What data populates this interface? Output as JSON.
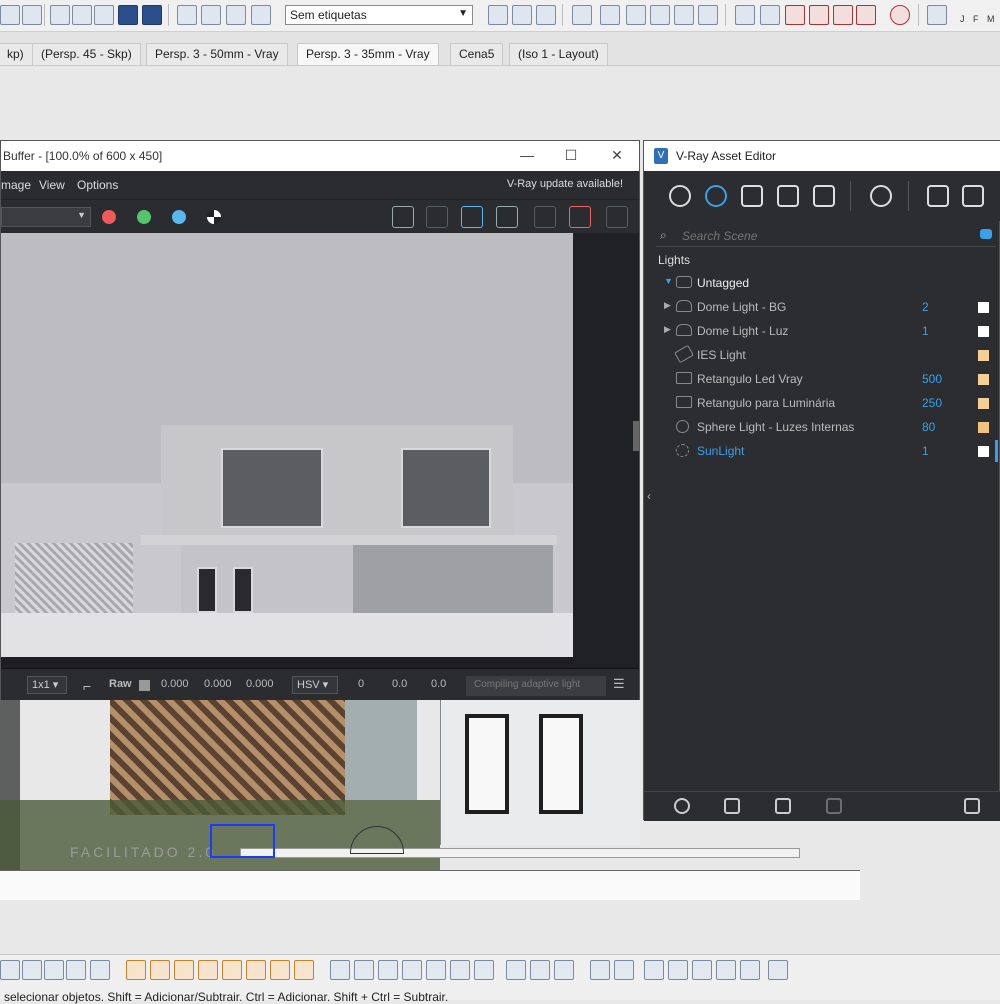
{
  "toolbar": {
    "tag_select_value": "Sem etiquetas",
    "month_strip": "J F M"
  },
  "scene_tabs": [
    {
      "label": "kp)"
    },
    {
      "label": "(Persp. 45 - Skp)"
    },
    {
      "label": "Persp. 3 - 50mm - Vray"
    },
    {
      "label": "Persp. 3 - 35mm - Vray"
    },
    {
      "label": "Cena5"
    },
    {
      "label": "(Iso 1 - Layout)"
    }
  ],
  "frame_buffer": {
    "title": "Buffer - [100.0% of 600 x 450]",
    "menus": [
      "mage",
      "View",
      "Options"
    ],
    "update_notice": "V-Ray update available!",
    "status": {
      "zoom": "1x1",
      "raw_label": "Raw",
      "rgb": [
        "0.000",
        "0.000",
        "0.000"
      ],
      "color_mode": "HSV",
      "hsv": [
        "0",
        "0.0",
        "0.0"
      ],
      "progress": "Compiling adaptive light"
    }
  },
  "asset_editor": {
    "title": "V-Ray Asset Editor",
    "search_placeholder": "Search Scene",
    "section": "Lights",
    "group": "Untagged",
    "lights": [
      {
        "name": "Dome Light - BG",
        "value": "2",
        "color": "#ffffff",
        "expandable": true
      },
      {
        "name": "Dome Light - Luz",
        "value": "1",
        "color": "#ffffff",
        "expandable": true
      },
      {
        "name": "IES Light",
        "value": "",
        "color": "#f4cf98",
        "expandable": false
      },
      {
        "name": "Retangulo Led Vray",
        "value": "500",
        "color": "#f4cf98",
        "expandable": false
      },
      {
        "name": "Retangulo para Luminária",
        "value": "250",
        "color": "#f4cf98",
        "expandable": false
      },
      {
        "name": "Sphere Light - Luzes Internas",
        "value": "80",
        "color": "#f0c27e",
        "expandable": false
      },
      {
        "name": "SunLight",
        "value": "1",
        "color": "#ffffff",
        "expandable": false,
        "selected": true
      }
    ]
  },
  "viewport": {
    "watermark": "FACILITADO 2.0"
  },
  "status_bar": {
    "text": "selecionar objetos. Shift = Adicionar/Subtrair. Ctrl = Adicionar. Shift + Ctrl = Subtrair."
  },
  "colors": {
    "accent": "#3aa0e8",
    "panel_bg": "#2b2d30"
  }
}
